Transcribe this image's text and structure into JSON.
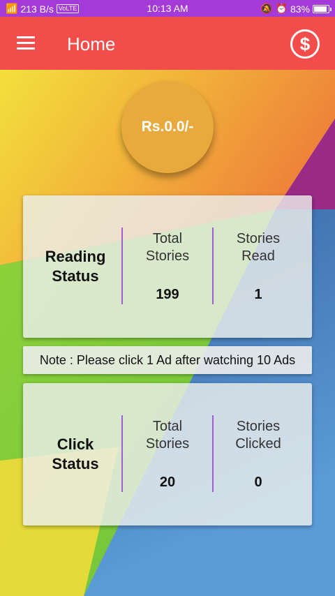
{
  "status_bar": {
    "signal_text": "''il .ıll",
    "speed": "213 B/s",
    "volte": "VoLTE",
    "time": "10:13 AM",
    "battery": "83%"
  },
  "app_bar": {
    "title": "Home",
    "menu_icon": "hamburger-icon",
    "coin_icon": "dollar-coin-icon",
    "coin_glyph": "$"
  },
  "balance": "Rs.0.0/-",
  "reading_status": {
    "label_line1": "Reading",
    "label_line2": "Status",
    "col1_line1": "Total",
    "col1_line2": "Stories",
    "col1_value": "199",
    "col2_line1": "Stories",
    "col2_line2": "Read",
    "col2_value": "1"
  },
  "note": "Note : Please click 1 Ad after watching 10 Ads",
  "click_status": {
    "label_line1": "Click",
    "label_line2": "Status",
    "col1_line1": "Total",
    "col1_line2": "Stories",
    "col1_value": "20",
    "col2_line1": "Stories",
    "col2_line2": "Clicked",
    "col2_value": "0"
  },
  "colors": {
    "status_bar": "#a43ad8",
    "app_bar": "#f24d4a",
    "divider": "#a45bd6",
    "balance_circle": "#e8aa3c"
  }
}
